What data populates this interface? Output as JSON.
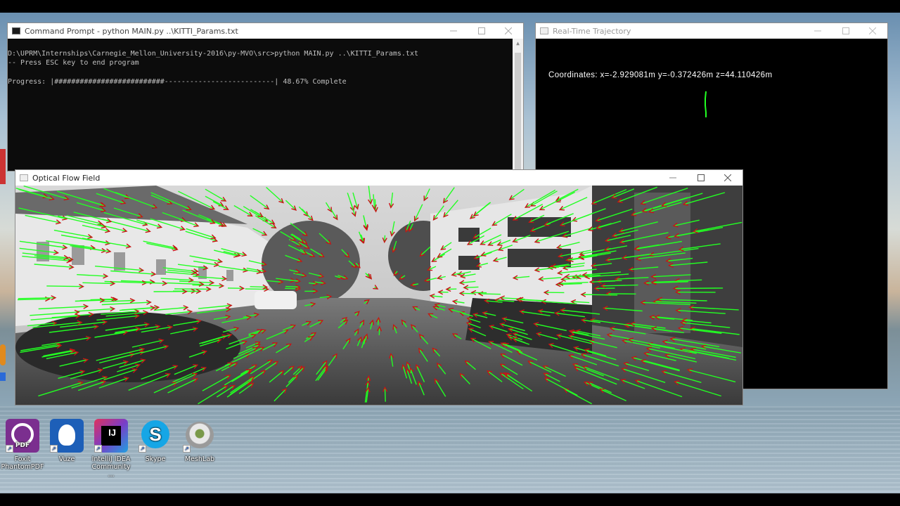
{
  "cmd_window": {
    "title": "Command Prompt - python  MAIN.py ..\\KITTI_Params.txt",
    "line1": "D:\\UPRM\\Internships\\Carnegie_Mellon_University-2016\\py-MVO\\src>python MAIN.py ..\\KITTI_Params.txt",
    "line2": "-- Press ESC key to end program",
    "progress_label": "Progress: ",
    "progress_bar": "|##########################--------------------------| ",
    "progress_text": "48.67% Complete",
    "progress_fraction": 0.4867
  },
  "trajectory_window": {
    "title": "Real-Time Trajectory",
    "coordinates": "Coordinates: x=-2.929081m y=-0.372426m z=44.110426m"
  },
  "flow_window": {
    "title": "Optical Flow Field"
  },
  "desktop_icons": [
    {
      "name": "foxit",
      "label": "Foxit\nPhantomPDF",
      "color": "#7b2f8f"
    },
    {
      "name": "vuze",
      "label": "Vuze",
      "color": "#1d5fb8"
    },
    {
      "name": "intellij",
      "label": "IntelliJ IDEA\nCommunity ...",
      "color": "#e0325d"
    },
    {
      "name": "skype",
      "label": "Skype",
      "color": "#16a6e6"
    },
    {
      "name": "meshlab",
      "label": "MeshLab",
      "color": "#cfcfcf"
    }
  ],
  "colors": {
    "flow_green": "#22ff22",
    "flow_red": "#c81414",
    "console_bg": "#0c0c0c",
    "console_fg": "#c0c0c0"
  }
}
